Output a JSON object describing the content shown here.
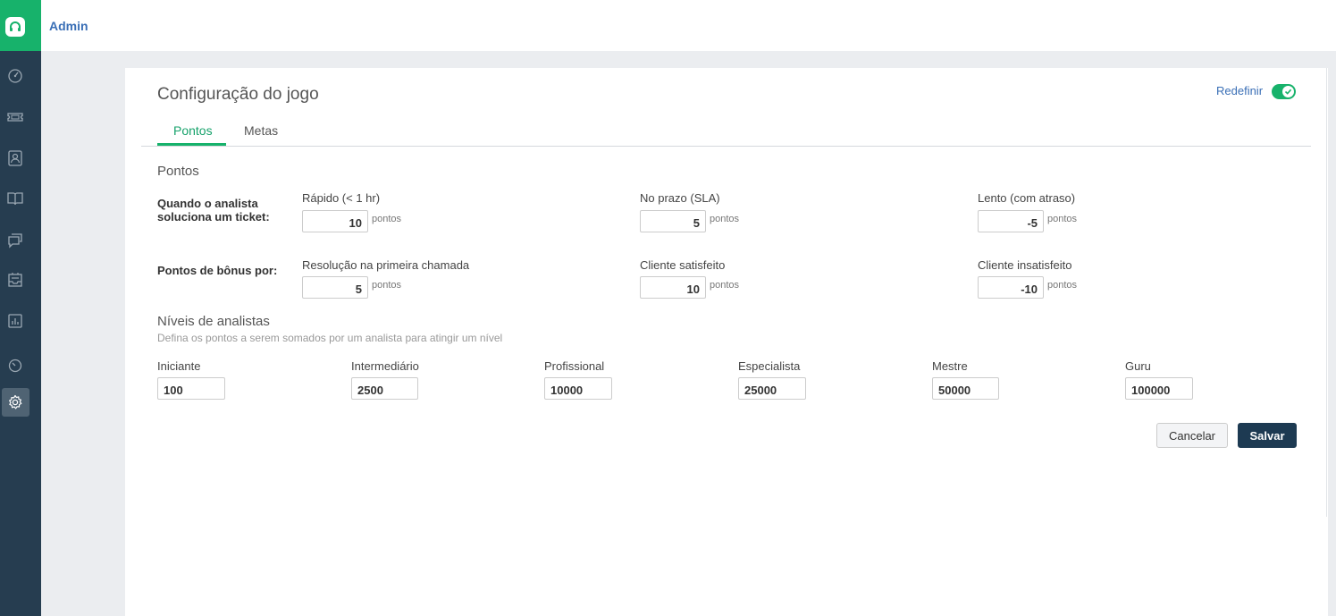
{
  "header": {
    "title": "Admin"
  },
  "sidebar": {
    "items": [
      {
        "icon": "gauge-icon"
      },
      {
        "icon": "ticket-icon"
      },
      {
        "icon": "contact-icon"
      },
      {
        "icon": "book-icon"
      },
      {
        "icon": "chat-icon"
      },
      {
        "icon": "inbox-icon"
      },
      {
        "icon": "chart-icon"
      },
      {
        "icon": "speedometer-icon"
      },
      {
        "icon": "gear-icon",
        "active": true
      }
    ]
  },
  "page": {
    "title": "Configuração do jogo",
    "reset_label": "Redefinir",
    "reset_enabled": true,
    "tabs": [
      {
        "label": "Pontos",
        "active": true
      },
      {
        "label": "Metas",
        "active": false
      }
    ]
  },
  "points": {
    "section_title": "Pontos",
    "unit": "pontos",
    "resolve_row": {
      "label": "Quando o analista soluciona um ticket:",
      "fields": [
        {
          "label": "Rápido (< 1 hr)",
          "value": "10"
        },
        {
          "label": "No prazo (SLA)",
          "value": "5"
        },
        {
          "label": "Lento (com atraso)",
          "value": "-5"
        }
      ]
    },
    "bonus_row": {
      "label": "Pontos de bônus por:",
      "fields": [
        {
          "label": "Resolução na primeira chamada",
          "value": "5"
        },
        {
          "label": "Cliente satisfeito",
          "value": "10"
        },
        {
          "label": "Cliente insatisfeito",
          "value": "-10"
        }
      ]
    }
  },
  "levels": {
    "title": "Níveis de analistas",
    "description": "Defina os pontos a serem somados por um analista para atingir um nível",
    "items": [
      {
        "label": "Iniciante",
        "value": "100"
      },
      {
        "label": "Intermediário",
        "value": "2500"
      },
      {
        "label": "Profissional",
        "value": "10000"
      },
      {
        "label": "Especialista",
        "value": "25000"
      },
      {
        "label": "Mestre",
        "value": "50000"
      },
      {
        "label": "Guru",
        "value": "100000"
      }
    ]
  },
  "actions": {
    "cancel_label": "Cancelar",
    "save_label": "Salvar"
  },
  "colors": {
    "accent": "#17b26b",
    "sidebar": "#263d50",
    "primary_button": "#1d3a52",
    "link": "#3a6fb6"
  }
}
